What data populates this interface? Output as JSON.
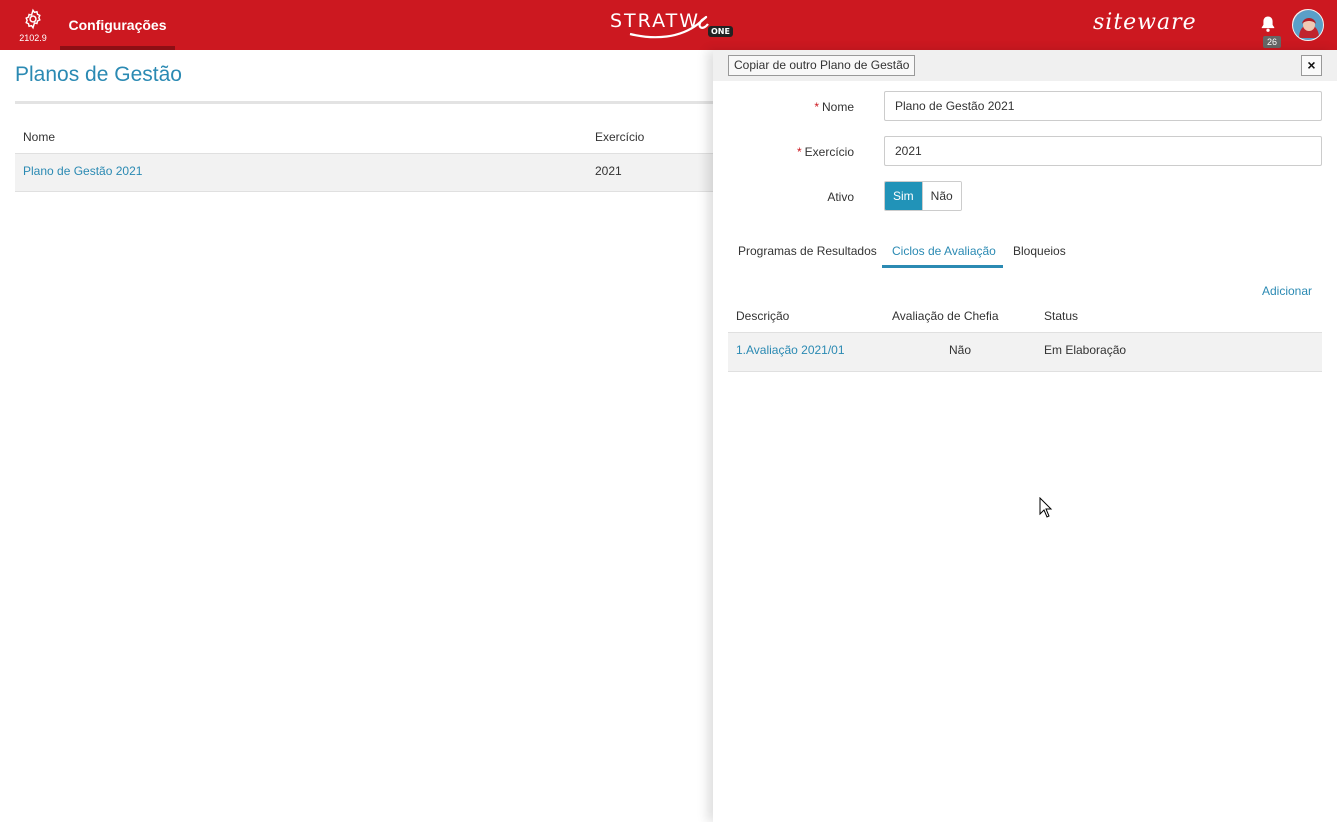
{
  "header": {
    "version": "2102.9",
    "nav_tab": "Configurações",
    "logo_text": "STRATW",
    "logo_badge": "ONE",
    "brand": "siteware",
    "notification_count": "26",
    "accent_color": "#cc1820"
  },
  "page": {
    "title": "Planos de Gestão",
    "columns": [
      "Nome",
      "Exercício"
    ],
    "rows": [
      {
        "nome": "Plano de Gestão 2021",
        "exercicio": "2021"
      }
    ]
  },
  "panel": {
    "copy_button": "Copiar de outro Plano de Gestão",
    "close_button": "×",
    "fields": {
      "nome_label": "Nome",
      "nome_value": "Plano de Gestão 2021",
      "exercicio_label": "Exercício",
      "exercicio_value": "2021",
      "ativo_label": "Ativo",
      "ativo_yes": "Sim",
      "ativo_no": "Não"
    },
    "tabs": [
      "Programas de Resultados",
      "Ciclos de Avaliação",
      "Bloqueios"
    ],
    "active_tab": "Ciclos de Avaliação",
    "add_link": "Adicionar",
    "table": {
      "columns": [
        "Descrição",
        "Avaliação de Chefia",
        "Status"
      ],
      "rows": [
        {
          "descricao": "1.Avaliação 2021/01",
          "chefia": "Não",
          "status": "Em Elaboração"
        }
      ]
    }
  }
}
